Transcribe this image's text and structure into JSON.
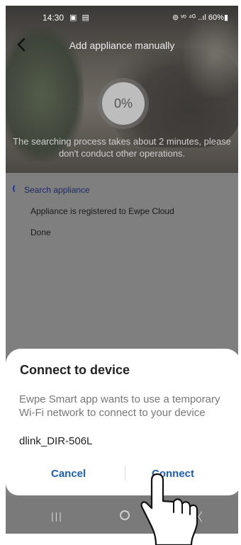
{
  "status_bar": {
    "time": "14:30",
    "left_icons": "▣ ▤",
    "right_text": "⊚ ᵛᵒ ⁴ᴳ ..ıl 60%▮"
  },
  "header": {
    "title": "Add appliance manually",
    "back_icon": "chevron-left-icon"
  },
  "progress": {
    "percent_text": "0%",
    "percent_value": 0,
    "note": "The searching process takes about 2 minutes, please don't conduct other operations."
  },
  "steps": [
    {
      "label": "Search appliance",
      "state": "active"
    },
    {
      "label": "Appliance is registered to Ewpe Cloud",
      "state": "pending"
    },
    {
      "label": "Done",
      "state": "pending"
    }
  ],
  "dialog": {
    "title": "Connect to device",
    "message": "Ewpe Smart app wants to use a temporary Wi-Fi network to connect to your device",
    "network": "dlink_DIR-506L",
    "cancel_label": "Cancel",
    "connect_label": "Connect"
  },
  "navbar": {
    "recents": "|||",
    "back": "〈"
  },
  "colors": {
    "overlay": "#7f7f7f",
    "accent_blue": "#1a5fb8",
    "dialog_bg": "#ffffff"
  }
}
